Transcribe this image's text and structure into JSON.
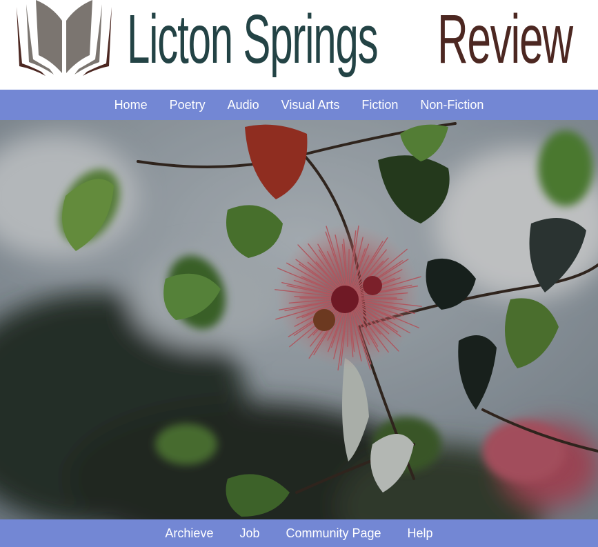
{
  "site": {
    "title_part1": "Licton Springs",
    "title_part2": "Review",
    "logo_icon": "open-book-icon"
  },
  "nav_top": {
    "items": [
      {
        "label": "Home"
      },
      {
        "label": "Poetry"
      },
      {
        "label": "Audio"
      },
      {
        "label": "Visual Arts"
      },
      {
        "label": "Fiction"
      },
      {
        "label": "Non-Fiction"
      }
    ]
  },
  "hero": {
    "image_subject": "photo of red ohia lehua blossom among leaves"
  },
  "nav_bottom": {
    "items": [
      {
        "label": "Archieve"
      },
      {
        "label": "Job"
      },
      {
        "label": "Community Page"
      },
      {
        "label": "Help"
      }
    ]
  },
  "colors": {
    "nav_bg": "#7387d4",
    "title_dark": "#234345",
    "title_brown": "#4c2721",
    "logo_gray": "#7b7570",
    "logo_brown": "#4c2721"
  }
}
